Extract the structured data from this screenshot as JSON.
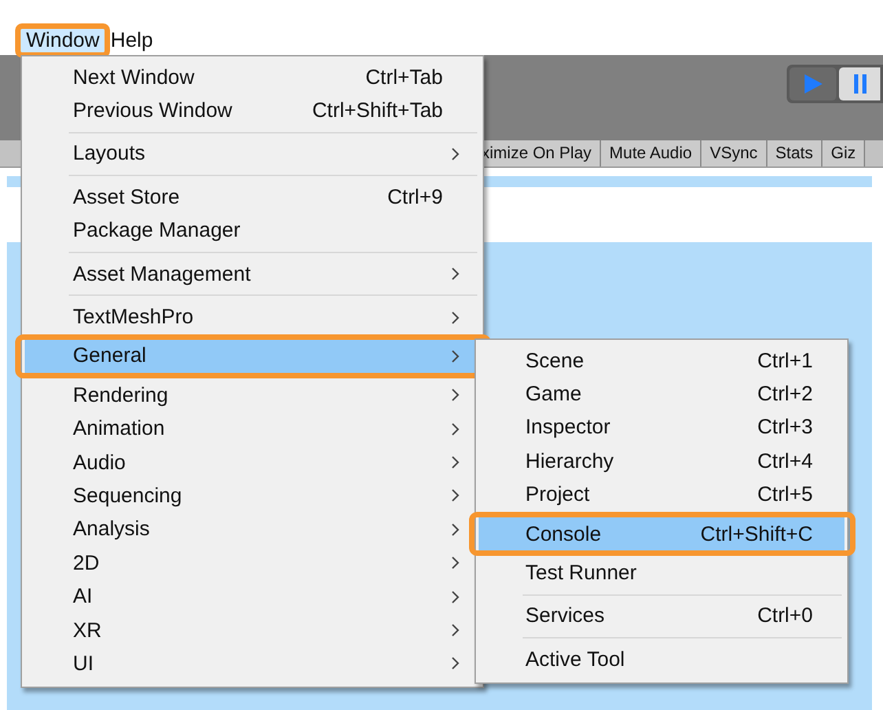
{
  "menu_bar": [
    {
      "label": "Window",
      "selected": true
    },
    {
      "label": "Help",
      "selected": false
    }
  ],
  "toolbar_tabs": [
    "ximize On Play",
    "Mute Audio",
    "VSync",
    "Stats",
    "Giz"
  ],
  "window_menu": {
    "groups": [
      [
        {
          "label": "Next Window",
          "shortcut": "Ctrl+Tab",
          "submenu": false,
          "selected": false
        },
        {
          "label": "Previous Window",
          "shortcut": "Ctrl+Shift+Tab",
          "submenu": false,
          "selected": false
        }
      ],
      [
        {
          "label": "Layouts",
          "submenu": true,
          "selected": false
        }
      ],
      [
        {
          "label": "Asset Store",
          "shortcut": "Ctrl+9",
          "submenu": false,
          "selected": false
        },
        {
          "label": "Package Manager",
          "submenu": false,
          "selected": false
        }
      ],
      [
        {
          "label": "Asset Management",
          "submenu": true,
          "selected": false
        }
      ],
      [
        {
          "label": "TextMeshPro",
          "submenu": true,
          "selected": false
        },
        {
          "label": "General",
          "submenu": true,
          "selected": true
        },
        {
          "label": "Rendering",
          "submenu": true,
          "selected": false
        },
        {
          "label": "Animation",
          "submenu": true,
          "selected": false
        },
        {
          "label": "Audio",
          "submenu": true,
          "selected": false
        },
        {
          "label": "Sequencing",
          "submenu": true,
          "selected": false
        },
        {
          "label": "Analysis",
          "submenu": true,
          "selected": false
        },
        {
          "label": "2D",
          "submenu": true,
          "selected": false
        },
        {
          "label": "AI",
          "submenu": true,
          "selected": false
        },
        {
          "label": "XR",
          "submenu": true,
          "selected": false
        },
        {
          "label": "UI",
          "submenu": true,
          "selected": false
        }
      ]
    ]
  },
  "general_submenu": {
    "groups": [
      [
        {
          "label": "Scene",
          "shortcut": "Ctrl+1",
          "selected": false
        },
        {
          "label": "Game",
          "shortcut": "Ctrl+2",
          "selected": false
        },
        {
          "label": "Inspector",
          "shortcut": "Ctrl+3",
          "selected": false
        },
        {
          "label": "Hierarchy",
          "shortcut": "Ctrl+4",
          "selected": false
        },
        {
          "label": "Project",
          "shortcut": "Ctrl+5",
          "selected": false
        },
        {
          "label": "Console",
          "shortcut": "Ctrl+Shift+C",
          "selected": true
        },
        {
          "label": "Test Runner",
          "selected": false
        }
      ],
      [
        {
          "label": "Services",
          "shortcut": "Ctrl+0",
          "selected": false
        }
      ],
      [
        {
          "label": "Active Tool",
          "selected": false
        }
      ]
    ]
  }
}
